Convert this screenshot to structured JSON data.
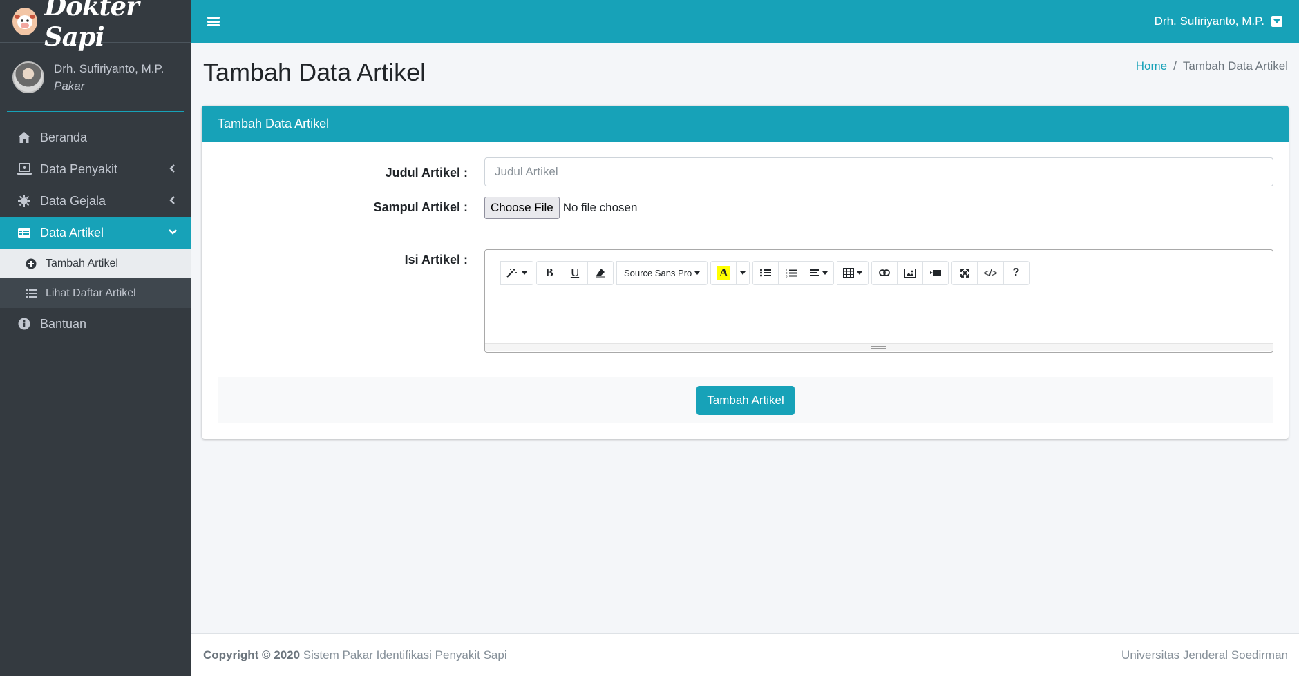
{
  "brand": {
    "name": "Dokter Sapi",
    "logo_icon": "cow-icon"
  },
  "user_panel": {
    "name": "Drh. Sufiriyanto, M.P.",
    "role": "Pakar"
  },
  "sidebar": {
    "items": [
      {
        "label": "Beranda",
        "icon": "home-icon"
      },
      {
        "label": "Data Penyakit",
        "icon": "laptop-medical-icon"
      },
      {
        "label": "Data Gejala",
        "icon": "virus-icon"
      },
      {
        "label": "Data Artikel",
        "icon": "table-icon"
      },
      {
        "label": "Bantuan",
        "icon": "info-circle-icon"
      }
    ],
    "sub_items": [
      {
        "label": "Tambah Artikel",
        "icon": "plus-circle-icon"
      },
      {
        "label": "Lihat Daftar Artikel",
        "icon": "list-icon"
      }
    ]
  },
  "topbar": {
    "user": "Drh. Sufiriyanto, M.P."
  },
  "page": {
    "title": "Tambah Data Artikel"
  },
  "breadcrumb": {
    "home": "Home",
    "current": "Tambah Data Artikel"
  },
  "card": {
    "header": "Tambah Data Artikel",
    "judul_label": "Judul Artikel :",
    "judul_placeholder": "Judul Artikel",
    "judul_value": "",
    "sampul_label": "Sampul Artikel :",
    "choose_file": "Choose File",
    "no_file": "No file chosen",
    "isi_label": "Isi Artikel :",
    "font_name": "Source Sans Pro",
    "submit": "Tambah Artikel"
  },
  "footer": {
    "copyright_bold": "Copyright © 2020",
    "copyright_text": "Sistem Pakar Identifikasi Penyakit Sapi",
    "university": "Universitas Jenderal Soedirman"
  },
  "colors": {
    "accent": "#17a2b8",
    "sidebar_bg": "#343a40",
    "content_bg": "#f4f6f9"
  }
}
